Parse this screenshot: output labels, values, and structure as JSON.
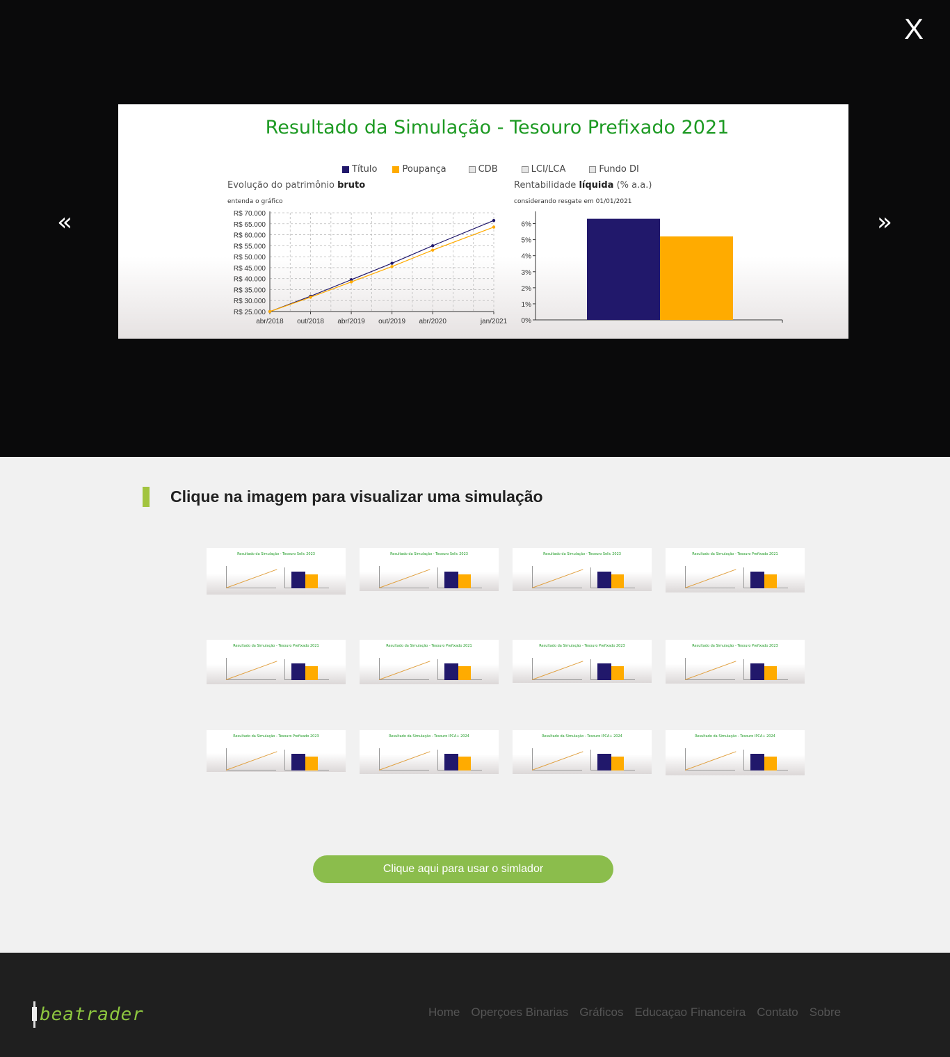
{
  "lightbox": {
    "close_label": "X",
    "prev_label": "«",
    "next_label": "»",
    "slide": {
      "title": "Resultado da Simulação - Tesouro Prefixado 2021",
      "legend": [
        {
          "label": "Título",
          "color": "#21186b",
          "checked": true
        },
        {
          "label": "Poupança",
          "color": "#ffab00",
          "checked": true
        },
        {
          "label": "CDB",
          "color": "#e6e6e6",
          "checked": false
        },
        {
          "label": "LCI/LCA",
          "color": "#e6e6e6",
          "checked": false
        },
        {
          "label": "Fundo DI",
          "color": "#e6e6e6",
          "checked": false
        }
      ],
      "left_label_prefix": "Evolução do patrimônio ",
      "left_label_bold": "bruto",
      "left_sub": "entenda o gráfico",
      "right_label_prefix": "Rentabilidade ",
      "right_label_bold": "líquida",
      "right_label_suffix": " (% a.a.)",
      "right_sub": "considerando resgate em 01/01/2021"
    }
  },
  "chart_data": [
    {
      "type": "line",
      "title": "Evolução do patrimônio bruto",
      "x": [
        "abr/2018",
        "out/2018",
        "abr/2019",
        "out/2019",
        "abr/2020",
        "jan/2021"
      ],
      "x_pos": [
        0,
        6,
        12,
        18,
        24,
        33
      ],
      "y_ticks": [
        "R$ 25.000",
        "R$ 30.000",
        "R$ 35.000",
        "R$ 40.000",
        "R$ 45.000",
        "R$ 50.000",
        "R$ 55.000",
        "R$ 60.000",
        "R$ 65.000",
        "R$ 70.000"
      ],
      "ylim": [
        25000,
        70000
      ],
      "series": [
        {
          "name": "Título",
          "color": "#21186b",
          "values": [
            25000,
            32000,
            39500,
            47000,
            55000,
            66500
          ]
        },
        {
          "name": "Poupança",
          "color": "#ffab00",
          "values": [
            25000,
            31500,
            38500,
            45500,
            53000,
            63500
          ]
        }
      ],
      "grid": true
    },
    {
      "type": "bar",
      "title": "Rentabilidade líquida (% a.a.)",
      "categories": [
        "Título",
        "Poupança"
      ],
      "colors": [
        "#21186b",
        "#ffab00"
      ],
      "values": [
        6.3,
        5.2
      ],
      "y_ticks": [
        "0%",
        "1%",
        "2%",
        "3%",
        "4%",
        "5%",
        "6%"
      ],
      "ylim": [
        0,
        6.5
      ]
    }
  ],
  "section": {
    "title": "Clique na imagem para visualizar uma simulação"
  },
  "thumbnails": [
    {
      "title": "Resultado da Simulação - Tesouro Selic 2023"
    },
    {
      "title": "Resultado da Simulação - Tesouro Selic 2023"
    },
    {
      "title": "Resultado da Simulação - Tesouro Selic 2023"
    },
    {
      "title": "Resultado da Simulação - Tesouro Prefixado 2021"
    },
    {
      "title": "Resultado da Simulação - Tesouro Prefixado 2021"
    },
    {
      "title": "Resultado da Simulação - Tesouro Prefixado 2021"
    },
    {
      "title": "Resultado da Simulação - Tesouro Prefixado 2023"
    },
    {
      "title": "Resultado da Simulação - Tesouro Prefixado 2023"
    },
    {
      "title": "Resultado da Simulação - Tesouro Prefixado 2023"
    },
    {
      "title": "Resultado da Simulação - Tesouro IPCA+ 2024"
    },
    {
      "title": "Resultado da Simulação - Tesouro IPCA+ 2024"
    },
    {
      "title": "Resultado da Simulação - Tesouro IPCA+ 2024"
    }
  ],
  "cta": {
    "label": "Clique aqui para usar o simlador"
  },
  "footer": {
    "logo_text": "beatrader",
    "links": [
      "Home",
      "Operçoes Binarias",
      "Gráficos",
      "Educaçao Financeira",
      "Contato",
      "Sobre"
    ]
  }
}
